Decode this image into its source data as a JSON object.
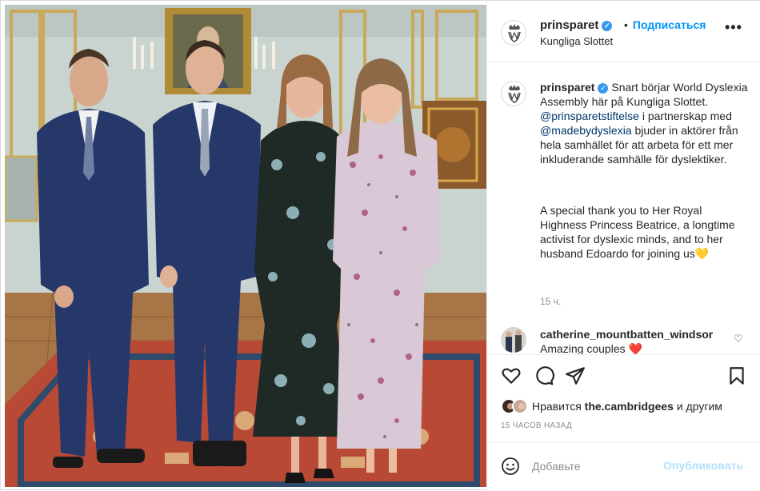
{
  "post": {
    "username": "prinsparet",
    "follow_label": "Подписаться",
    "location": "Kungliga Slottet",
    "more_label": "•••"
  },
  "caption": {
    "username": "prinsparet",
    "text_1": "Snart börjar World Dyslexia Assembly här på Kungliga Slottet.",
    "mention_1": "@prinsparetstiftelse",
    "text_2": "i partnerskap med",
    "mention_2": "@madebydyslexia",
    "text_3": "bjuder in aktörer från hela samhället för att arbeta för ett mer inkluderande samhälle för dyslektiker.",
    "text_4": "A special thank you to Her Royal Highness Princess Beatrice, a longtime activist for dyslexic minds, and to her husband Edoardo for joining us💛",
    "time": "15 ч."
  },
  "comment": {
    "username": "catherine_mountbatten_windsor",
    "text": "Amazing couples ❤️"
  },
  "likes": {
    "prefix": "Нравится",
    "user": "the.cambridgees",
    "suffix": "и другим"
  },
  "timestamp": "15 ЧАСОВ НАЗАД",
  "add_comment": {
    "placeholder": "Добавьте",
    "post_label": "Опубликовать"
  },
  "icons": {
    "like": "heart-icon",
    "comment": "comment-icon",
    "share": "paper-plane-icon",
    "save": "bookmark-icon",
    "emoji": "smiley-icon",
    "verified": "verified-badge-icon"
  },
  "colors": {
    "accent": "#0095f6",
    "verified": "#3897f0",
    "muted": "#8e8e8e",
    "post_disabled": "#b2dffc"
  }
}
